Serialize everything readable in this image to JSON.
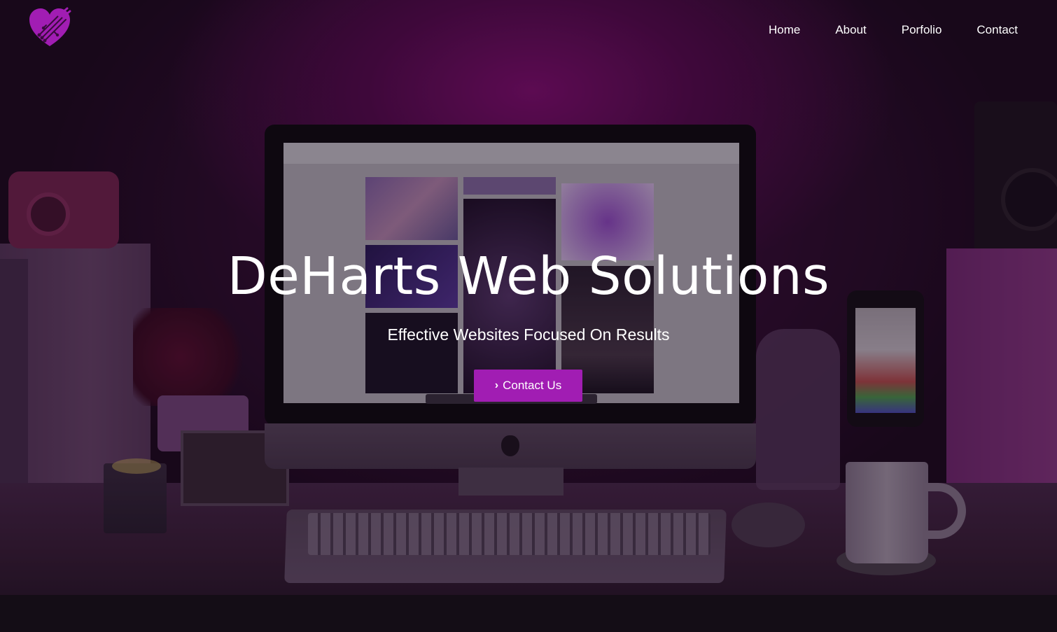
{
  "brand": {
    "logo_icon": "heart-circuit-icon",
    "accent_color": "#a11db3"
  },
  "nav": {
    "items": [
      {
        "label": "Home"
      },
      {
        "label": "About"
      },
      {
        "label": "Porfolio"
      },
      {
        "label": "Contact"
      }
    ]
  },
  "hero": {
    "title": "DeHarts Web Solutions",
    "subtitle": "Effective Websites Focused On Results",
    "cta_label": "Contact Us",
    "cta_icon": "chevron-right-icon"
  }
}
